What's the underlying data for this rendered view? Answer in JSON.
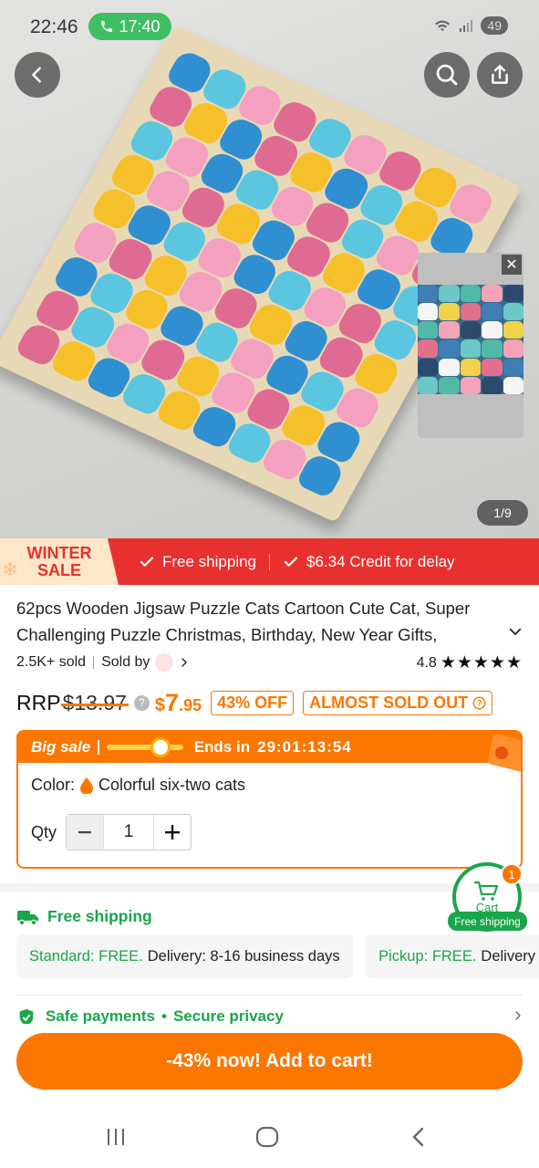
{
  "status_bar": {
    "time": "22:46",
    "call_duration": "17:40",
    "battery": "49"
  },
  "gallery": {
    "page_counter": "1/9"
  },
  "banner": {
    "winter_line1": "WINTER",
    "winter_line2": "SALE",
    "item1": "Free shipping",
    "item2": "$6.34 Credit for delay"
  },
  "product": {
    "title": "62pcs Wooden Jigsaw Puzzle Cats Cartoon Cute Cat, Super Challenging Puzzle Christmas, Birthday, New Year Gifts,",
    "sold": "2.5K+ sold",
    "sold_by": "Sold by",
    "rating": "4.8",
    "stars": "★★★★★"
  },
  "price": {
    "rrp_label": "RRP",
    "rrp_value": "$13.97",
    "currency": "$",
    "now_int": "7",
    "now_dec": ".95",
    "discount": "43% OFF",
    "stock": "ALMOST SOLD OUT"
  },
  "sale": {
    "label": "Big sale",
    "ends_label": "Ends in",
    "countdown": "29:01:13:54",
    "progress": 0.7,
    "color_label": "Color:",
    "color_value": "Colorful six-two cats",
    "qty_label": "Qty",
    "qty_value": "1"
  },
  "cart": {
    "badge": "1",
    "label": "Cart",
    "free_shipping": "Free shipping"
  },
  "shipping": {
    "heading": "Free shipping",
    "standard_label": "Standard: FREE.",
    "standard_detail": "Delivery: 8-16 business days",
    "pickup_label": "Pickup: FREE.",
    "pickup_detail": "Delivery"
  },
  "safety": {
    "left": "Safe payments",
    "right": "Secure privacy"
  },
  "cta": {
    "label": "-43% now! Add to cart!"
  },
  "colors": {
    "accent": "#fb7701",
    "sale_red": "#e8312f",
    "green": "#1aa64a"
  },
  "icons": [
    "back-arrow-icon",
    "search-icon",
    "share-icon",
    "close-icon",
    "truck-icon",
    "shield-check-icon",
    "cart-icon",
    "chevron-down-icon",
    "chevron-right-icon",
    "recent-apps-icon",
    "home-icon",
    "nav-back-icon"
  ]
}
